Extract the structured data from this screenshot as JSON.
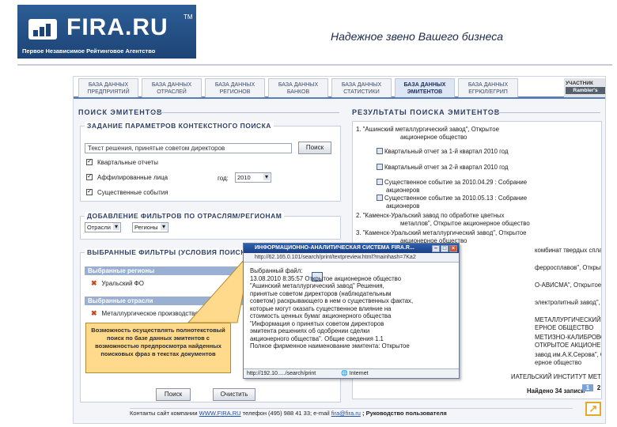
{
  "logo": {
    "name": "FIRA.RU",
    "tm": "TM",
    "tagline": "Первое Независимое Рейтинговое Агентство"
  },
  "slogan": "Надежное звено Вашего бизнеса",
  "tabs": [
    {
      "label": "БАЗА ДАННЫХ ПРЕДПРИЯТИЙ",
      "active": false
    },
    {
      "label": "БАЗА ДАННЫХ ОТРАСЛЕЙ",
      "active": false
    },
    {
      "label": "БАЗА ДАННЫХ РЕГИОНОВ",
      "active": false
    },
    {
      "label": "БАЗА ДАННЫХ БАНКОВ",
      "active": false
    },
    {
      "label": "БАЗА ДАННЫХ СТАТИСТИКИ",
      "active": false
    },
    {
      "label": "БАЗА ДАННЫХ ЭМИТЕНТОВ",
      "active": true
    },
    {
      "label": "БАЗА ДАННЫХ ЕГРЮЛ/ЕГРИП",
      "active": false
    }
  ],
  "partner": {
    "label": "УЧАСТНИК",
    "brand": "Rambler's",
    "extra": "TOP"
  },
  "search_panel": {
    "title": "ПОИСК ЭМИТЕНТОВ",
    "context_box_title": "ЗАДАНИЕ ПАРАМЕТРОВ КОНТЕКСТНОГО ПОИСКА",
    "query_value": "Текст решения, принятые советом директоров",
    "search_button": "Поиск",
    "checkboxes": [
      "Квартальные отчеты",
      "Аффилированные лица",
      "Существенные события"
    ],
    "year_label": "год:",
    "year_value": "2010",
    "filters_box_title": "ДОБАВЛЕНИЕ ФИЛЬТРОВ ПО ОТРАСЛЯМ/РЕГИОНАМ",
    "filter_buttons": [
      "Отрасли",
      "Регионы"
    ],
    "active_filters_title": "ВЫБРАННЫЕ ФИЛЬТРЫ (УСЛОВИЯ ПОИСКА)",
    "selected_regions_label": "Выбранные регионы",
    "selected_regions": [
      "Уральский ФО"
    ],
    "selected_branches_label": "Выбранные отрасли",
    "selected_branches": [
      "Металлургическое производство (27)"
    ],
    "bottom_buttons": [
      "Поиск",
      "Очистить"
    ]
  },
  "callout": "Возможность осуществлять полнотекстовый поиск по базе данных эмитентов с возможностью предпросмотра найденных поисковых фраз в текстах документов",
  "results_panel": {
    "title": "РЕЗУЛЬТАТЫ ПОИСКА ЭМИТЕНТОВ",
    "rows": [
      "1. \"Ашинский металлургический завод\", Открытое",
      "акционерное общество",
      "Квартальный отчет за 1-й квартал 2010 год",
      "Квартальный отчет за 2-й квартал 2010 год",
      "Существенное событие за 2010.04.29 : Собрание",
      "акционеров",
      "Существенное событие за 2010.05.13 : Собрание",
      "акционеров",
      "2. \"Каменск-Уральский завод по обработке цветных",
      "металлов\", Открытое акционерное общество",
      "3. \"Каменск-Уральский металлургический завод\", Открытое",
      "акционерное общество",
      "комбинат твердых сплавов\", Открытое",
      "ферросплавов\", Открытое",
      "О-АВИСМА\", Открытое акционерное",
      "электролитный завод\", Закрытое",
      "МЕТАЛЛУРГИЧЕСКИЙ КОМБИНАТ\",",
      "ЕРНОЕ ОБЩЕСТВО",
      "МЕТИЗНО-КАЛИБРОВОЧНЫЙ ЗАВОД",
      "ОТКРЫТОЕ АКЦИОНЕРНОЕ ОБЩЕСТВО",
      "завод им.А.К.Серова\", Открытое",
      "ерное общество",
      "ИАТЕЛЬСКИЙ ИНСТИТУТ МЕТАЛЛОВ\""
    ],
    "found_text": "Найдено 34 записи",
    "pages": [
      "1",
      "2"
    ]
  },
  "popup": {
    "title": "ИНФОРМАЦИОННО-АНАЛИТИЧЕСКАЯ СИСТЕМА FIRA.R...",
    "address": "http://62.165.0.101/search/print/textpreview.html?mainhash=7Ka2",
    "body_lines": [
      "Выбранный файл:",
      "13.08.2010 8:35:57 Открытое акционерное общество",
      "\"Ашинский металлургический завод\" Решения,",
      "принятые советом директоров (наблюдательным",
      "советом) раскрывающего в нем о существенных фактах,",
      "которые могут оказать существенное влияние на",
      "стоимость ценных бумаг акционерного общества",
      "\"Информация о принятых советом директоров",
      "эмитента решениях об одобрении сделки",
      "акционерного общества\". Общие сведения 1.1",
      "Полное фирменное наименование эмитента: Открытое"
    ],
    "status_url": "http://192.10...../search/print",
    "status_zone": "Internet"
  },
  "footer": {
    "prefix": "Контакты сайт компании",
    "site": "WWW.FIRA.RU",
    "phone": " телефон (495) 988 41 33; e-mail",
    "email": "fira@fira.ru",
    "suffix": "; Руководство пользователя"
  },
  "slide_pages": [
    "1",
    "2"
  ],
  "expand_icon": "expand-arrow-icon"
}
